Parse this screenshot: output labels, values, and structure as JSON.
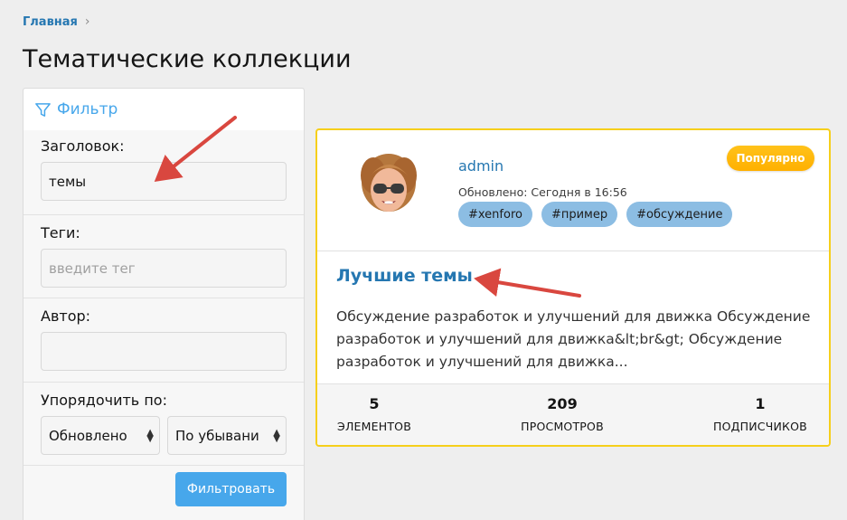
{
  "breadcrumb": {
    "home": "Главная",
    "separator": "›"
  },
  "page": {
    "title": "Тематические коллекции"
  },
  "filter": {
    "heading": "Фильтр",
    "title_label": "Заголовок:",
    "title_value": "темы",
    "tags_label": "Теги:",
    "tags_placeholder": "введите тег",
    "author_label": "Автор:",
    "author_value": "",
    "order_label": "Упорядочить по:",
    "order_field": "Обновлено",
    "order_direction": "По убывани",
    "submit_label": "Фильтровать"
  },
  "collection": {
    "username": "admin",
    "updated": "Обновлено: Сегодня в 16:56",
    "badge": "Популярно",
    "tags": [
      "#xenforo",
      "#пример",
      "#обсуждение"
    ],
    "title": "Лучшие темы",
    "description": "Обсуждение разработок и улучшений для движка Обсуждение разработок и улучшений для движка&lt;br&gt; Обсуждение разработок и улучшений для движка...",
    "stats": [
      {
        "value": "5",
        "label": "ЭЛЕМЕНТОВ"
      },
      {
        "value": "209",
        "label": "ПРОСМОТРОВ"
      },
      {
        "value": "1",
        "label": "ПОДПИСЧИКОВ"
      }
    ]
  },
  "colors": {
    "accent": "#47a7eb",
    "link": "#2577b1",
    "card_border": "#f6cf1b",
    "badge": "#ffb800",
    "annotation_arrow": "#d9473f"
  },
  "icons": {
    "filter": "funnel-icon",
    "sort": "up-down-arrows-icon"
  }
}
